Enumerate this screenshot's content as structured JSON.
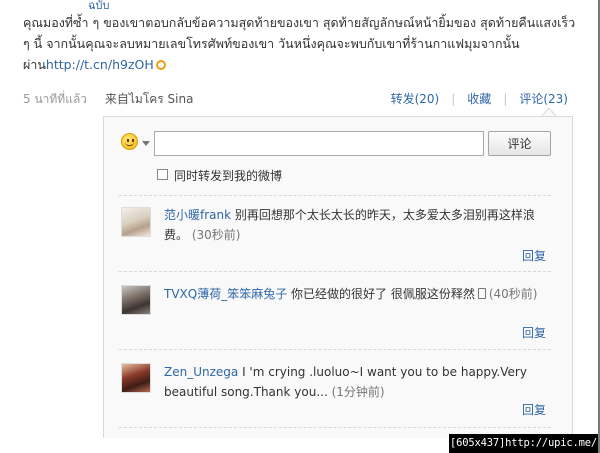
{
  "post": {
    "top_cut_text": "ฉบับ",
    "text": "คุณมองที่ซ้ำ ๆ ของเขาตอบกลับข้อความสุดท้ายของเขา สุดท้ายสัญลักษณ์หน้ายิ้มของ สุดท้ายคืนแสงเร็ว ๆ นี้ จากนั้นคุณจะลบหมายเลขโทรศัพท์ของเขา วันหนึ่งคุณจะพบกับเขาที่ร้านกาแฟมุมจากนั้นผ่าน",
    "link": "http://t.cn/h9zOH",
    "time": "5 นาทีที่แล้ว",
    "source": "来自ไมโคร Sina"
  },
  "actions": {
    "repost": "转发(20)",
    "favorite": "收藏",
    "comment": "评论(23)"
  },
  "composer": {
    "input_value": "",
    "submit_label": "评论",
    "repost_checkbox_label": "同时转发到我的微博",
    "repost_checked": false
  },
  "comments": [
    {
      "user": "范小暖frank",
      "text": " 别再回想那个太长太长的昨天，太多爱太多泪别再这样浪费。",
      "time": "(30秒前)",
      "reply": "回复"
    },
    {
      "user": "TVXQ薄荷_笨笨麻兔子",
      "text": "  你已经做的很好了  很佩服这份释然",
      "time": "(40秒前)",
      "reply": "回复"
    },
    {
      "user": "Zen_Unzega",
      "text": " I 'm crying .luoluo~I want you to be happy.Very beautiful song.Thank you...",
      "time": " (1分钟前)",
      "reply": "回复"
    }
  ],
  "watermark": "[605x437]http://upic.me/",
  "colors": {
    "link": "#2f67a8",
    "box_bg": "#f9f9f9",
    "link_icon": "#f29b19"
  }
}
